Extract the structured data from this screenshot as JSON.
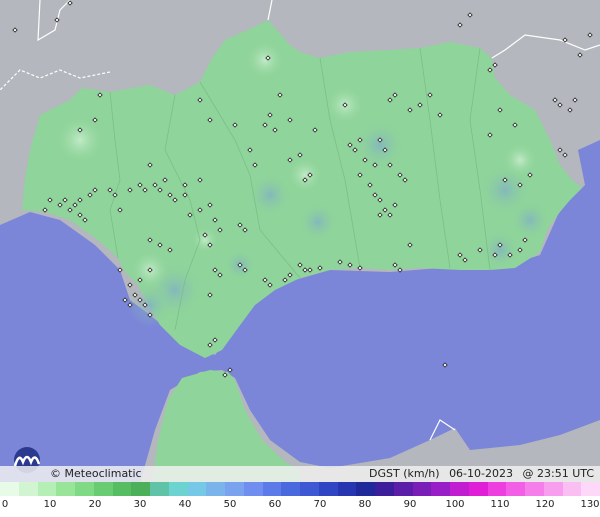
{
  "map": {
    "brand": "© Meteoclimatic",
    "variable": "DGST (km/h)",
    "date": "06-10-2023",
    "time": "@ 23:51 UTC",
    "colors": {
      "sea": "#7b86d9",
      "land_outside": "#b4b7bd",
      "region": "#8fd49a",
      "border": "#ffffff",
      "station": "#222222"
    }
  },
  "legend": {
    "ticks": [
      "0",
      "10",
      "20",
      "30",
      "40",
      "50",
      "60",
      "70",
      "80",
      "90",
      "100",
      "110",
      "120",
      "130"
    ],
    "colors": [
      "#e8fbe8",
      "#d0f5d0",
      "#b5efb5",
      "#98e59a",
      "#7fd985",
      "#69cb72",
      "#56bd63",
      "#4caf5a",
      "#60c3a8",
      "#6dd3d0",
      "#75c8e6",
      "#7ab4ea",
      "#7aa2ee",
      "#6f8ef0",
      "#5d7be8",
      "#4b69df",
      "#3e57d2",
      "#2f45c3",
      "#2736b0",
      "#20299a",
      "#3d1e9a",
      "#5a1ea8",
      "#7a1eb8",
      "#9a1ec8",
      "#c01ed0",
      "#e01ed8",
      "#ee3ee0",
      "#f25ee6",
      "#f57eea",
      "#f89eee",
      "#fbbef3",
      "#fdd8f8"
    ]
  }
}
